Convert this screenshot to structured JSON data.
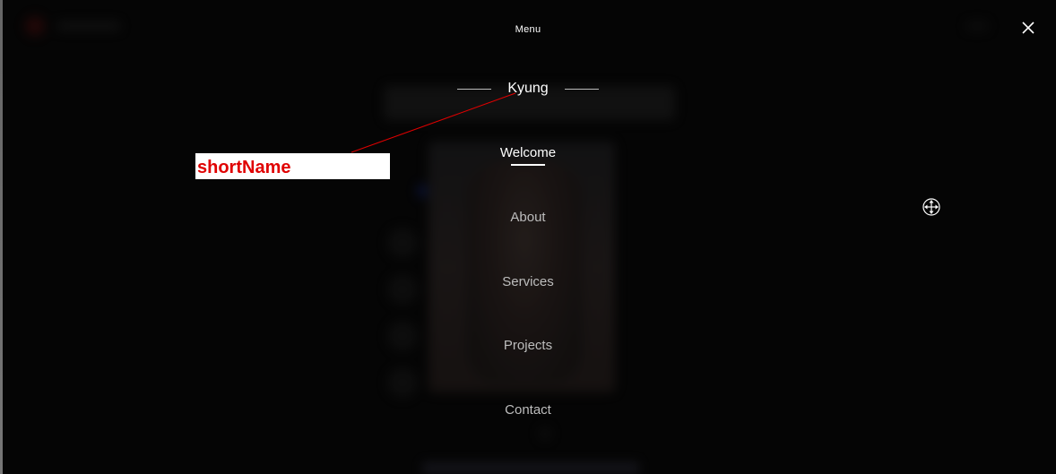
{
  "menu": {
    "title": "Menu",
    "close_label": "✕"
  },
  "brand": {
    "name": "Kyung"
  },
  "nav": {
    "items": [
      {
        "label": "Welcome",
        "active": true
      },
      {
        "label": "About",
        "active": false
      },
      {
        "label": "Services",
        "active": false
      },
      {
        "label": "Projects",
        "active": false
      },
      {
        "label": "Contact",
        "active": false
      }
    ]
  },
  "annotation": {
    "label": "shortName",
    "color": "#e00000"
  },
  "icons": {
    "close": "close-icon",
    "move": "move-cursor-icon"
  }
}
